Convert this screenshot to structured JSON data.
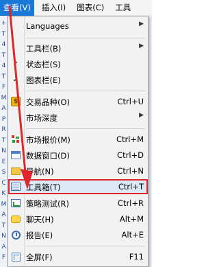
{
  "menubar": {
    "items": [
      {
        "label": "查看(V)",
        "active": true
      },
      {
        "label": "插入(I)",
        "active": false
      },
      {
        "label": "图表(C)",
        "active": false
      },
      {
        "label": "工具",
        "active": false
      }
    ]
  },
  "background_marks": [
    "+",
    "T",
    "4",
    "T",
    "4",
    "T",
    "F",
    "M",
    "A",
    "P",
    "R",
    "T",
    "N",
    "E",
    "S",
    "C",
    "K",
    "M",
    "A",
    "T",
    "N",
    "A",
    "F"
  ],
  "menu": {
    "items": [
      {
        "label": "Languages",
        "shortcut": "",
        "submenu": true,
        "icon": ""
      },
      {
        "label": "工具栏(B)",
        "shortcut": "",
        "submenu": true,
        "icon": ""
      },
      {
        "label": "状态栏(S)",
        "shortcut": "",
        "submenu": false,
        "icon": "",
        "checked": true
      },
      {
        "label": "图表栏(E)",
        "shortcut": "",
        "submenu": false,
        "icon": "",
        "checked": true
      },
      {
        "label": "交易品种(O)",
        "shortcut": "Ctrl+U",
        "submenu": false,
        "icon": "symbols-icon"
      },
      {
        "label": "市场深度",
        "shortcut": "",
        "submenu": true,
        "icon": ""
      },
      {
        "label": "市场报价(M)",
        "shortcut": "Ctrl+M",
        "submenu": false,
        "icon": "market-watch-icon"
      },
      {
        "label": "数据窗口(D)",
        "shortcut": "Ctrl+D",
        "submenu": false,
        "icon": "data-window-icon"
      },
      {
        "label": "导航(N)",
        "shortcut": "Ctrl+N",
        "submenu": false,
        "icon": "navigator-icon"
      },
      {
        "label": "工具箱(T)",
        "shortcut": "Ctrl+T",
        "submenu": false,
        "icon": "toolbox-icon",
        "highlighted": true
      },
      {
        "label": "策略测试(R)",
        "shortcut": "Ctrl+R",
        "submenu": false,
        "icon": "strategy-tester-icon"
      },
      {
        "label": "聊天(H)",
        "shortcut": "Alt+M",
        "submenu": false,
        "icon": "chat-icon"
      },
      {
        "label": "报告(E)",
        "shortcut": "Alt+E",
        "submenu": false,
        "icon": "report-icon"
      },
      {
        "label": "全屏(F)",
        "shortcut": "F11",
        "submenu": false,
        "icon": "fullscreen-icon"
      }
    ]
  },
  "colors": {
    "menubar_active": "#1a78d6",
    "highlight_border": "#e0262b",
    "highlight_fill": "#dce9f7",
    "arrow": "#e0262b"
  }
}
